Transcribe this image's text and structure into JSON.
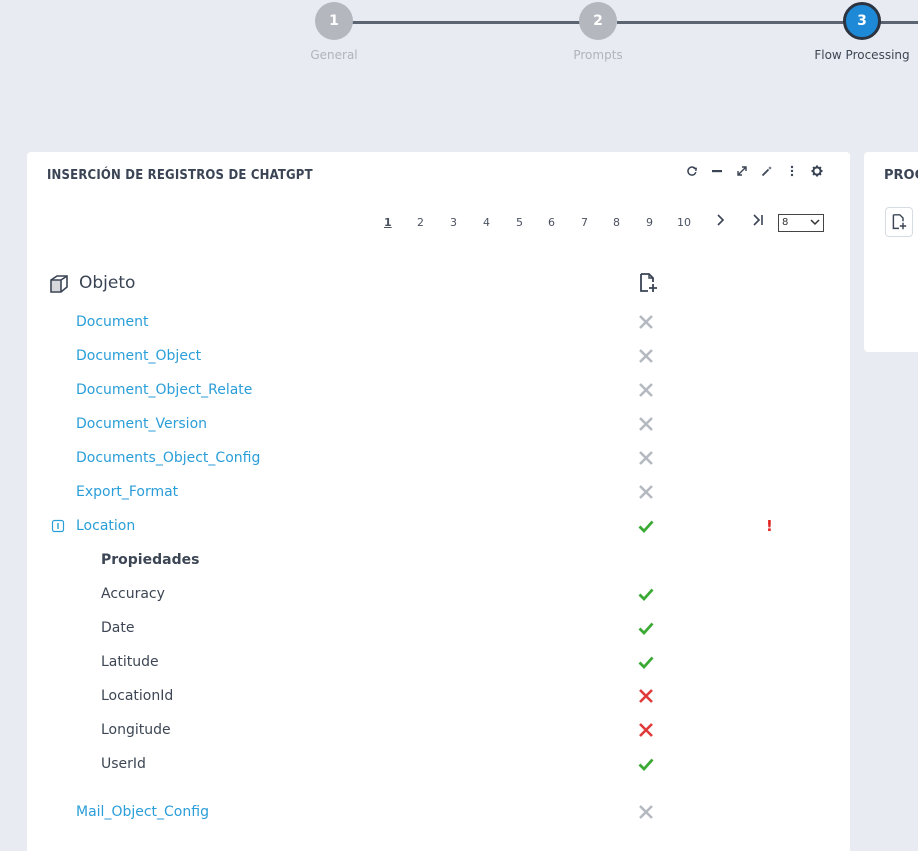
{
  "stepper": {
    "steps": [
      {
        "number": "1",
        "label": "General"
      },
      {
        "number": "2",
        "label": "Prompts"
      },
      {
        "number": "3",
        "label": "Flow Processing"
      }
    ],
    "active_step": 3
  },
  "card": {
    "title": "INSERCIÓN DE REGISTROS DE CHATGPT",
    "toolbar": [
      "refresh-icon",
      "minimize-icon",
      "expand-icon",
      "magic-wand-icon",
      "more-vertical-icon",
      "gear-icon"
    ],
    "pagination": {
      "pages": [
        "1",
        "2",
        "3",
        "4",
        "5",
        "6",
        "7",
        "8",
        "9",
        "10"
      ],
      "current": "1",
      "next": "›",
      "last": "›|",
      "page_size": "8"
    },
    "column_header": "Objeto",
    "objects": [
      {
        "name": "Document",
        "status": "gray-x"
      },
      {
        "name": "Document_Object",
        "status": "gray-x"
      },
      {
        "name": "Document_Object_Relate",
        "status": "gray-x"
      },
      {
        "name": "Document_Version",
        "status": "gray-x"
      },
      {
        "name": "Documents_Object_Config",
        "status": "gray-x"
      },
      {
        "name": "Export_Format",
        "status": "gray-x"
      },
      {
        "name": "Location",
        "status": "check",
        "warning": "!"
      },
      {
        "name": "Mail_Object_Config",
        "status": "gray-x"
      }
    ],
    "properties_label": "Propiedades",
    "properties": [
      {
        "name": "Accuracy",
        "status": "check"
      },
      {
        "name": "Date",
        "status": "check"
      },
      {
        "name": "Latitude",
        "status": "check"
      },
      {
        "name": "LocationId",
        "status": "red-x"
      },
      {
        "name": "Longitude",
        "status": "red-x"
      },
      {
        "name": "UserId",
        "status": "check"
      }
    ]
  },
  "card2": {
    "title": "PROC"
  },
  "colors": {
    "link": "#2a9ed8",
    "check": "#3aaa35",
    "red_x": "#e03a3a",
    "gray_x": "#b5b9c0",
    "active_step": "#1e8ad7"
  }
}
